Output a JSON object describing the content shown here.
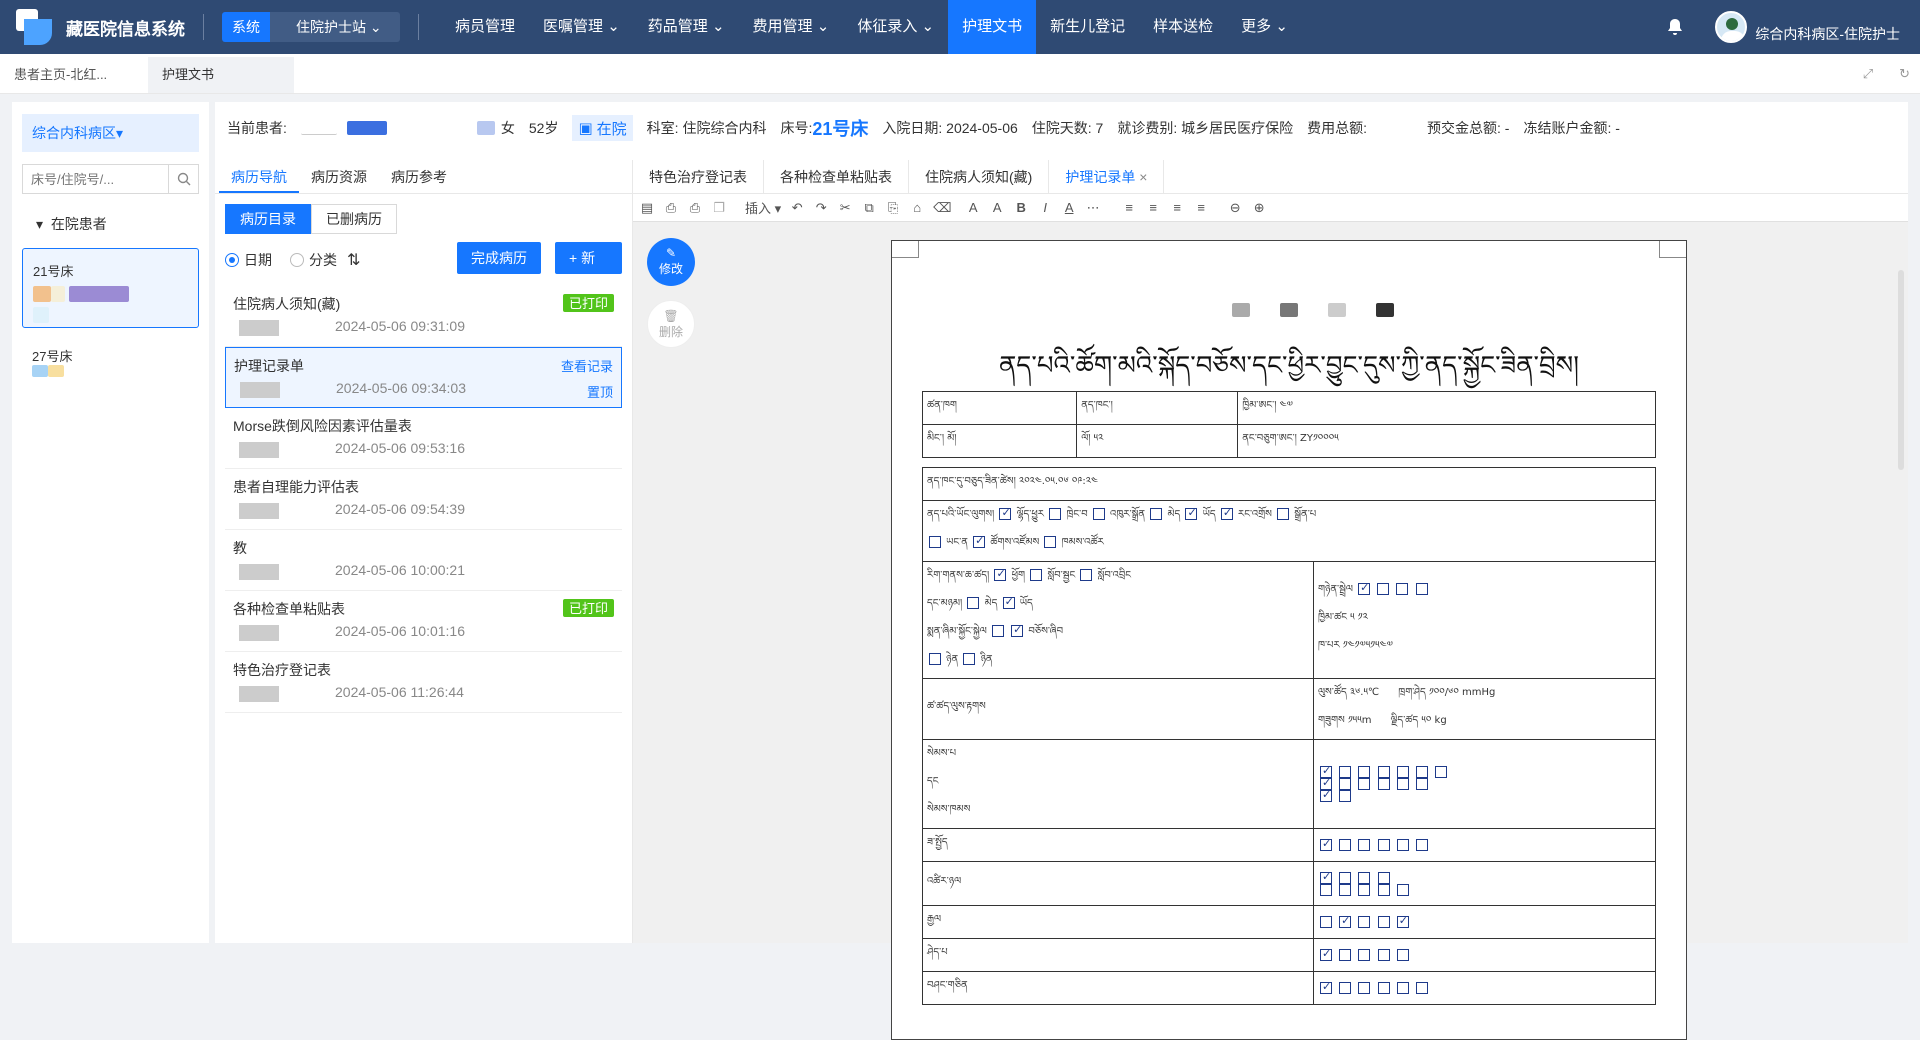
{
  "app": {
    "title": "藏医院信息系统",
    "system_label": "系统",
    "station": "住院护士站"
  },
  "nav": [
    {
      "label": "病员管理",
      "dropdown": false
    },
    {
      "label": "医嘱管理",
      "dropdown": true
    },
    {
      "label": "药品管理",
      "dropdown": true
    },
    {
      "label": "费用管理",
      "dropdown": true
    },
    {
      "label": "体征录入",
      "dropdown": true
    },
    {
      "label": "护理文书",
      "dropdown": false,
      "active": true
    },
    {
      "label": "新生儿登记",
      "dropdown": false
    },
    {
      "label": "样本送检",
      "dropdown": false
    },
    {
      "label": "更多",
      "dropdown": true
    }
  ],
  "user": {
    "name": "综合内科病区-住院护士"
  },
  "page_tabs": [
    {
      "label": "患者主页-北红..."
    },
    {
      "label": "护理文书",
      "active": true
    }
  ],
  "sidebar": {
    "ward": "综合内科病区▾",
    "search_placeholder": "床号/住院号/...",
    "group": "在院患者",
    "beds": [
      {
        "label": "21号床",
        "selected": true
      },
      {
        "label": "27号床",
        "selected": false
      }
    ]
  },
  "patient": {
    "current_label": "当前患者:",
    "gender": "女",
    "age": "52岁",
    "status": "在院",
    "dept": "科室: 住院综合内科",
    "bed_label": "床号:",
    "bed": "21号床",
    "admit_date": "入院日期: 2024-05-06",
    "days": "住院天数: 7",
    "insurance": "就诊费别: 城乡居民医疗保险",
    "total_fee": "费用总额:",
    "prepay": "预交金总额: -",
    "frozen": "冻结账户金额: -"
  },
  "nav_tabs": [
    {
      "label": "病历导航",
      "active": true
    },
    {
      "label": "病历资源"
    },
    {
      "label": "病历参考"
    }
  ],
  "segments": [
    {
      "label": "病历目录",
      "active": true
    },
    {
      "label": "已删病历"
    }
  ],
  "sort": {
    "date": "日期",
    "category": "分类"
  },
  "buttons": {
    "complete": "完成病历",
    "add": "+ 新增",
    "edit": "修改",
    "delete": "删除"
  },
  "records": [
    {
      "title": "住院病人须知(藏)",
      "date": "2024-05-06 09:31:09",
      "badge": "已打印"
    },
    {
      "title": "护理记录单",
      "date": "2024-05-06 09:34:03",
      "selected": true,
      "link1": "查看记录",
      "link2": "置顶"
    },
    {
      "title": "Morse跌倒风险因素评估量表",
      "date": "2024-05-06 09:53:16"
    },
    {
      "title": "患者自理能力评估表",
      "date": "2024-05-06 09:54:39"
    },
    {
      "title": "教",
      "date": "2024-05-06 10:00:21"
    },
    {
      "title": "各种检查单粘贴表",
      "date": "2024-05-06 10:01:16",
      "badge": "已打印"
    },
    {
      "title": "特色治疗登记表",
      "date": "2024-05-06 11:26:44"
    }
  ],
  "doc_tabs": [
    {
      "label": "特色治疗登记表"
    },
    {
      "label": "各种检查单粘贴表"
    },
    {
      "label": "住院病人须知(藏)"
    },
    {
      "label": "护理记录单",
      "active": true,
      "closable": true
    }
  ],
  "toolbar": {
    "insert": "插入"
  },
  "document": {
    "title": "ནད་པའི་ཚོག་མའི་སྐོད་བཅོས་དང་ཕྱིར་བྱུང་དུས་ཀྱི་ནད་སྐྱོང་ཟིན་བྲིས།",
    "r1": [
      "ཚན་ཁག",
      "ནད་ཁང་།",
      "ཁྱིམ་ཨང་། ༤༧"
    ],
    "r2": [
      "མིང་། མོ།",
      "ལོ། ༥༢",
      "ནང་བཅུག་ཨང་། ZY༡༠༠༠༥"
    ],
    "r3": "ནད་ཁང་དུ་བཅུད་ཟིན་ཚེས། ༢༠༢༤.༠༥.༠༦   ༠༩:༢༤",
    "vitals_temp": "༣༦.༥℃",
    "vitals_bp": "༡༠༠/༦༠ mmHg",
    "vitals_h": "༡༥༥m",
    "vitals_w": "༥༠ kg"
  }
}
